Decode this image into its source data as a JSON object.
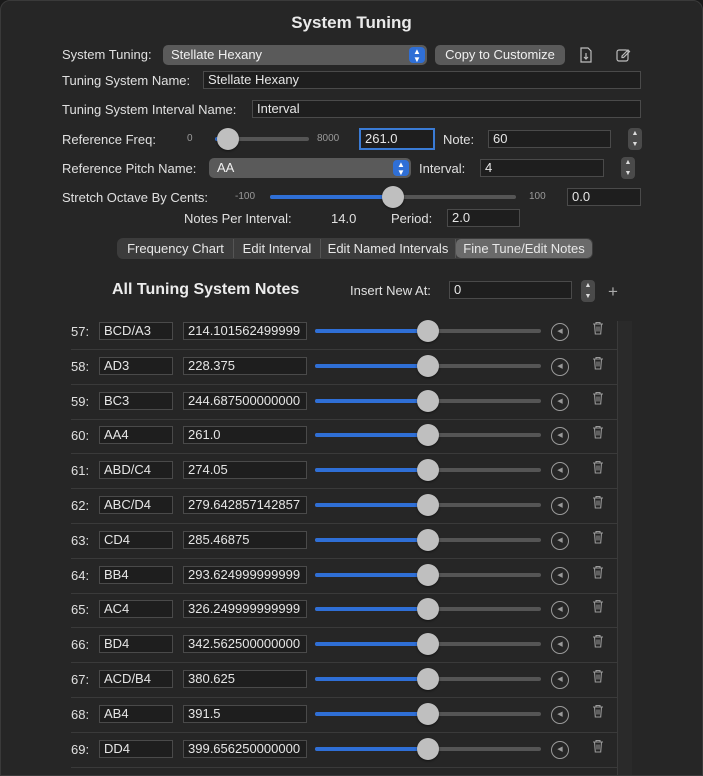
{
  "window": {
    "title": "System Tuning"
  },
  "system_tuning": {
    "label": "System Tuning:",
    "selected": "Stellate Hexany",
    "copy_button": "Copy to Customize",
    "export_icon": "document-export-icon",
    "edit_icon": "square-pencil-icon"
  },
  "tuning_name": {
    "label": "Tuning System Name:",
    "value": "Stellate Hexany"
  },
  "interval_name": {
    "label": "Tuning System Interval Name:",
    "value": "Interval"
  },
  "reference_freq": {
    "label": "Reference Freq:",
    "min": "0",
    "max": "8000",
    "value": "261.0",
    "slider_fraction": 0.033,
    "note_label": "Note:",
    "note_value": "60"
  },
  "reference_pitch": {
    "label": "Reference Pitch Name:",
    "selected": "AA",
    "interval_label": "Interval:",
    "interval_value": "4"
  },
  "stretch": {
    "label": "Stretch Octave By Cents:",
    "min": "-100",
    "max": "100",
    "value": "0.0",
    "slider_fraction": 0.5
  },
  "notes_info": {
    "notes_label": "Notes Per Interval:",
    "notes_value": "14.0",
    "period_label": "Period:",
    "period_value": "2.0"
  },
  "tabs": [
    {
      "label": "Frequency Chart",
      "active": false
    },
    {
      "label": "Edit Interval",
      "active": false
    },
    {
      "label": "Edit Named Intervals",
      "active": false
    },
    {
      "label": "Fine Tune/Edit Notes",
      "active": true
    }
  ],
  "notes_section": {
    "heading": "All Tuning System Notes",
    "insert_label": "Insert New At:",
    "insert_value": "0",
    "add_icon": "plus-icon"
  },
  "notes": [
    {
      "num": "57:",
      "name": "BCD/A3",
      "freq": "214.101562499999",
      "slider_fraction": 0.5
    },
    {
      "num": "58:",
      "name": "AD3",
      "freq": "228.375",
      "slider_fraction": 0.5
    },
    {
      "num": "59:",
      "name": "BC3",
      "freq": "244.687500000000",
      "slider_fraction": 0.5
    },
    {
      "num": "60:",
      "name": "AA4",
      "freq": "261.0",
      "slider_fraction": 0.5
    },
    {
      "num": "61:",
      "name": "ABD/C4",
      "freq": "274.05",
      "slider_fraction": 0.5
    },
    {
      "num": "62:",
      "name": "ABC/D4",
      "freq": "279.642857142857",
      "slider_fraction": 0.5
    },
    {
      "num": "63:",
      "name": "CD4",
      "freq": "285.46875",
      "slider_fraction": 0.5
    },
    {
      "num": "64:",
      "name": "BB4",
      "freq": "293.624999999999",
      "slider_fraction": 0.5
    },
    {
      "num": "65:",
      "name": "AC4",
      "freq": "326.249999999999",
      "slider_fraction": 0.5
    },
    {
      "num": "66:",
      "name": "BD4",
      "freq": "342.562500000000",
      "slider_fraction": 0.5
    },
    {
      "num": "67:",
      "name": "ACD/B4",
      "freq": "380.625",
      "slider_fraction": 0.5
    },
    {
      "num": "68:",
      "name": "AB4",
      "freq": "391.5",
      "slider_fraction": 0.5
    },
    {
      "num": "69:",
      "name": "DD4",
      "freq": "399.656250000000",
      "slider_fraction": 0.5
    }
  ],
  "colors": {
    "accent": "#2f6fd6",
    "background": "#262626",
    "field": "#1e1e1e"
  }
}
